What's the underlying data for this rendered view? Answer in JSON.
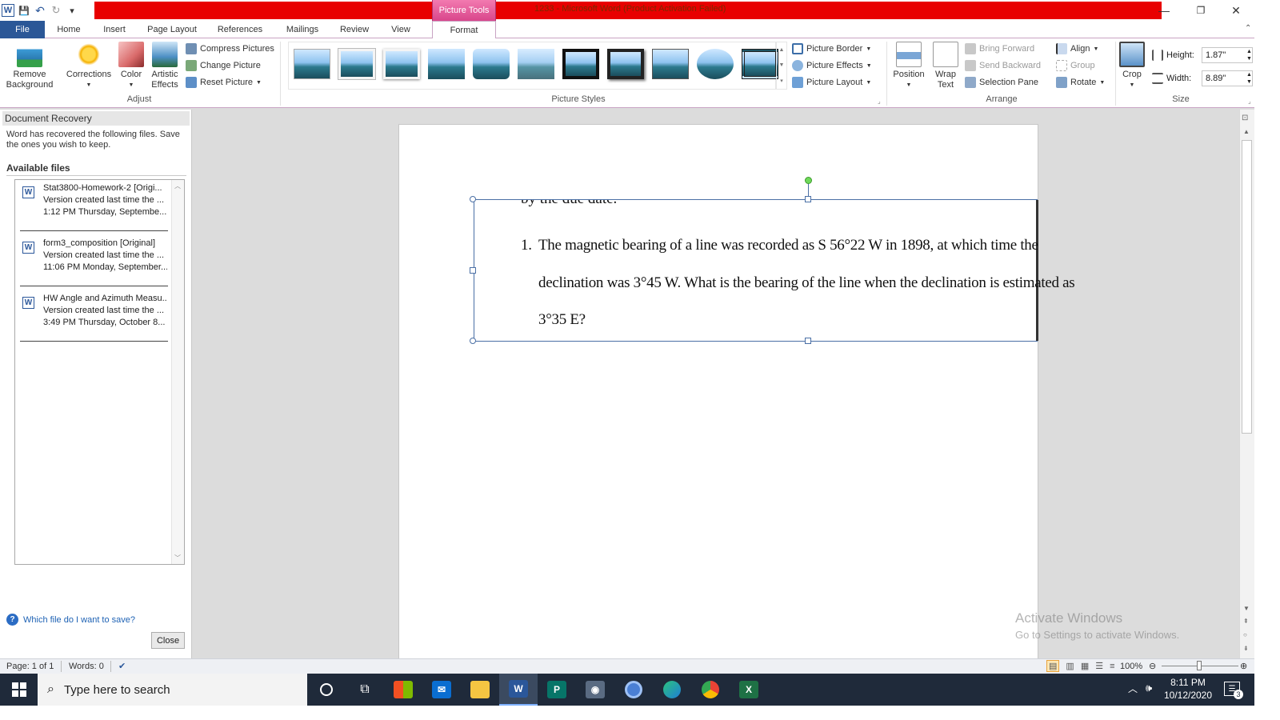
{
  "titlebar": {
    "window_title": "1233 - Microsoft Word (Product Activation Failed)",
    "contextual_tab": "Picture Tools",
    "minimize": "—",
    "restore": "❐",
    "close": "✕"
  },
  "qat": {
    "word_icon": "W",
    "save_icon": "💾",
    "undo_icon": "↶",
    "redo_icon": "↻",
    "customize_icon": "▾"
  },
  "tabs": [
    "File",
    "Home",
    "Insert",
    "Page Layout",
    "References",
    "Mailings",
    "Review",
    "View",
    "Format"
  ],
  "ribbon": {
    "adjust": {
      "remove_background": [
        "Remove",
        "Background"
      ],
      "corrections": "Corrections",
      "color": "Color",
      "artistic_effects": [
        "Artistic",
        "Effects"
      ],
      "compress": "Compress Pictures",
      "change": "Change Picture",
      "reset": "Reset Picture",
      "label": "Adjust"
    },
    "picture_styles": {
      "label": "Picture Styles",
      "border": "Picture Border",
      "effects": "Picture Effects",
      "layout": "Picture Layout"
    },
    "arrange": {
      "label": "Arrange",
      "position": "Position",
      "wrap": [
        "Wrap",
        "Text"
      ],
      "bring_forward": "Bring Forward",
      "send_backward": "Send Backward",
      "selection_pane": "Selection Pane",
      "align": "Align",
      "group": "Group",
      "rotate": "Rotate"
    },
    "size": {
      "label": "Size",
      "crop": "Crop",
      "height_label": "Height:",
      "height_value": "1.87\"",
      "width_label": "Width:",
      "width_value": "8.89\""
    }
  },
  "recovery": {
    "title": "Document Recovery",
    "description": "Word has recovered the following files.  Save the ones you wish to keep.",
    "available": "Available files",
    "files": [
      {
        "name": "Stat3800-Homework-2  [Origi...",
        "line2": "Version created last time the ...",
        "line3": "1:12 PM Thursday, Septembe..."
      },
      {
        "name": "form3_composition  [Original]",
        "line2": "Version created last time the ...",
        "line3": "11:06 PM Monday, September..."
      },
      {
        "name": "HW Angle and Azimuth Measu...",
        "line2": "Version created last time the ...",
        "line3": "3:49 PM Thursday, October 8..."
      }
    ],
    "help": "Which file do I want to save?",
    "close": "Close"
  },
  "document": {
    "cut_text": "by the due date.",
    "question_number": "1.",
    "lines": [
      "The magnetic bearing of a line was recorded as S 56°22 W in 1898, at which time the",
      "declination was 3°45 W. What is the bearing of the line when the declination is estimated as",
      "3°35 E?"
    ]
  },
  "watermark": {
    "line1": "Activate Windows",
    "line2": "Go to Settings to activate Windows."
  },
  "statusbar": {
    "page": "Page: 1 of 1",
    "words": "Words: 0",
    "zoom": "100%"
  },
  "taskbar": {
    "search_placeholder": "Type here to search",
    "time": "8:11 PM",
    "date": "10/12/2020",
    "notifications": "3"
  }
}
